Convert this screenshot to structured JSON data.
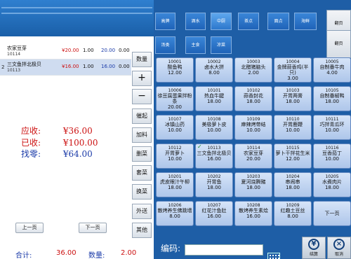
{
  "order": {
    "rows": [
      {
        "num": "",
        "name": "农家豆芽",
        "code": "10114",
        "price": "¥20.00",
        "qty": "1.00",
        "amount": "20.00",
        "unit": "0.00"
      },
      {
        "num": "2",
        "name": "三文鱼拌北极贝",
        "code": "10113",
        "price": "¥16.00",
        "qty": "1.00",
        "amount": "16.00",
        "unit": "0.00"
      }
    ]
  },
  "totals": {
    "receivable_label": "应收:",
    "receivable_value": "¥36.00",
    "received_label": "已收:",
    "received_value": "¥100.00",
    "change_label": "找零:",
    "change_value": "¥64.00"
  },
  "paging": {
    "prev": "上一页",
    "next": "下一页"
  },
  "summary": {
    "total_label": "合计:",
    "total_value": "36.00",
    "count_label": "数量:",
    "count_value": "2.00"
  },
  "side_actions": {
    "qty": "数量",
    "plus": "+",
    "minus": "−",
    "urge": "催起",
    "add": "加料",
    "delete": "删菜",
    "hold": "套菜",
    "swap": "换菜",
    "takeout": "外送",
    "other": "其他"
  },
  "categories": [
    {
      "label": "高牌"
    },
    {
      "label": "酒水"
    },
    {
      "label": "中厨"
    },
    {
      "label": "茶点"
    },
    {
      "label": "面点"
    },
    {
      "label": "海鲜"
    },
    {
      "label": "汤类"
    },
    {
      "label": "主食"
    },
    {
      "label": "凉菜"
    }
  ],
  "side_pages": {
    "up": "翻页",
    "down": "翻页"
  },
  "dishes": [
    {
      "code": "10001",
      "name": "酸鱼鸭",
      "price": "12.00"
    },
    {
      "code": "10002",
      "name": "卤水大拼",
      "price": "8.00"
    },
    {
      "code": "10003",
      "name": "北醋猪脑头",
      "price": "2.00"
    },
    {
      "code": "10004",
      "name": "金牌蒜香鸡(半只)",
      "price": "3.00"
    },
    {
      "code": "10005",
      "name": "自制番牛肉",
      "price": "4.00"
    },
    {
      "code": "10006",
      "name": "徐豆腐蛋果拌粉条",
      "price": "20.00"
    },
    {
      "code": "10101",
      "name": "热血牛腱",
      "price": "18.00"
    },
    {
      "code": "10102",
      "name": "蒜香封花",
      "price": "18.00"
    },
    {
      "code": "10103",
      "name": "开胃两膏",
      "price": "18.00"
    },
    {
      "code": "10105",
      "name": "自制番椒鸭",
      "price": "18.00"
    },
    {
      "code": "10107",
      "name": "冰镇山药",
      "price": "10.00"
    },
    {
      "code": "10108",
      "name": "美极萝卜皮",
      "price": "10.00"
    },
    {
      "code": "10109",
      "name": "麻辣烤带结",
      "price": "10.00"
    },
    {
      "code": "10110",
      "name": "开胃鹿鞭",
      "price": "10.00"
    },
    {
      "code": "10111",
      "name": "巧拌青瓜环",
      "price": "10.00"
    },
    {
      "code": "10112",
      "name": "开胃萝卜",
      "price": "10.00",
      "check": false
    },
    {
      "code": "10113",
      "name": "三文鱼拌北极贝",
      "price": "16.00",
      "check": true
    },
    {
      "code": "10114",
      "name": "农家豆芽",
      "price": "20.00"
    },
    {
      "code": "10115",
      "name": "萝卜干拌花生米",
      "price": "12.00"
    },
    {
      "code": "10116",
      "name": "豆香茄丁",
      "price": "10.00"
    },
    {
      "code": "10201",
      "name": "虎皮眼汁午柳",
      "price": "18.00"
    },
    {
      "code": "10202",
      "name": "开胃鱼",
      "price": "18.00"
    },
    {
      "code": "10203",
      "name": "夏河烧腾豬",
      "price": "18.00"
    },
    {
      "code": "10204",
      "name": "串闹串",
      "price": "18.00"
    },
    {
      "code": "10205",
      "name": "水煮肉片",
      "price": "18.00"
    },
    {
      "code": "10206",
      "name": "散烤养生佛跳墙",
      "price": "8.00"
    },
    {
      "code": "10207",
      "name": "红花汁鱼肚",
      "price": "16.00"
    },
    {
      "code": "10208",
      "name": "散烤养生素烩",
      "price": "16.00"
    },
    {
      "code": "10209",
      "name": "红趣土豆丝",
      "price": "8.00"
    },
    {
      "code": "",
      "name": "下一页",
      "price": ""
    }
  ],
  "code_bar": {
    "label": "编码:"
  },
  "actions": {
    "settle": "结算",
    "cancel": "取消"
  }
}
